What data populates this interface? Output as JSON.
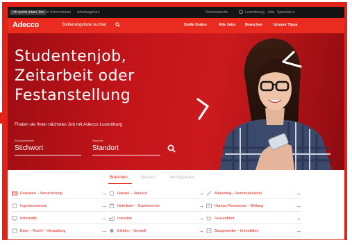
{
  "util": {
    "tabs": [
      "Ich suche einen Job",
      "Für Unternehmen",
      "Arbeitsagentur"
    ],
    "right": [
      "Standortsuche",
      "Luxembourg ∙ Jobs",
      "Sprachen ▾"
    ]
  },
  "header": {
    "logo": "Adecco",
    "search_label": "Stellenangebote suchen",
    "nav": [
      "Stelle finden",
      "Alle Jobs",
      "Branchen",
      "Unsere Tipps"
    ]
  },
  "hero": {
    "headline": [
      "Studentenjob,",
      "Zeitarbeit oder",
      "Festanstellung"
    ],
    "subtitle": "Finden sie Ihren nächsten Job mit Adecco Luxemburg",
    "keyword_label": "Schlüsselwörter",
    "keyword_value": "Stichwort",
    "location_label": "Standort",
    "location_value": "Standort"
  },
  "categories": {
    "tabs": [
      "Branchen",
      "Standort",
      "Vertragsarten"
    ],
    "items": [
      {
        "label": "Finanzen – Versicherung",
        "icon": "finance-icon"
      },
      {
        "label": "Handel – Verkauf",
        "icon": "handshake-icon"
      },
      {
        "label": "Marketing – Kommunikation",
        "icon": "pen-icon"
      },
      {
        "label": "Ingenieurwesen",
        "icon": "engineering-icon"
      },
      {
        "label": "Hotellerie – Gastronomie",
        "icon": "hotel-icon"
      },
      {
        "label": "Human Resources – Bildung",
        "icon": "hr-icon"
      },
      {
        "label": "Informatik",
        "icon": "computer-icon"
      },
      {
        "label": "Industrie",
        "icon": "industry-icon"
      },
      {
        "label": "Gesundheit",
        "icon": "health-icon"
      },
      {
        "label": "Büro – Recht – Verwaltung",
        "icon": "office-icon"
      },
      {
        "label": "Elektro – Umwelt",
        "icon": "electric-icon"
      },
      {
        "label": "Baugewerbe – Immobilien",
        "icon": "construction-icon"
      }
    ]
  }
}
